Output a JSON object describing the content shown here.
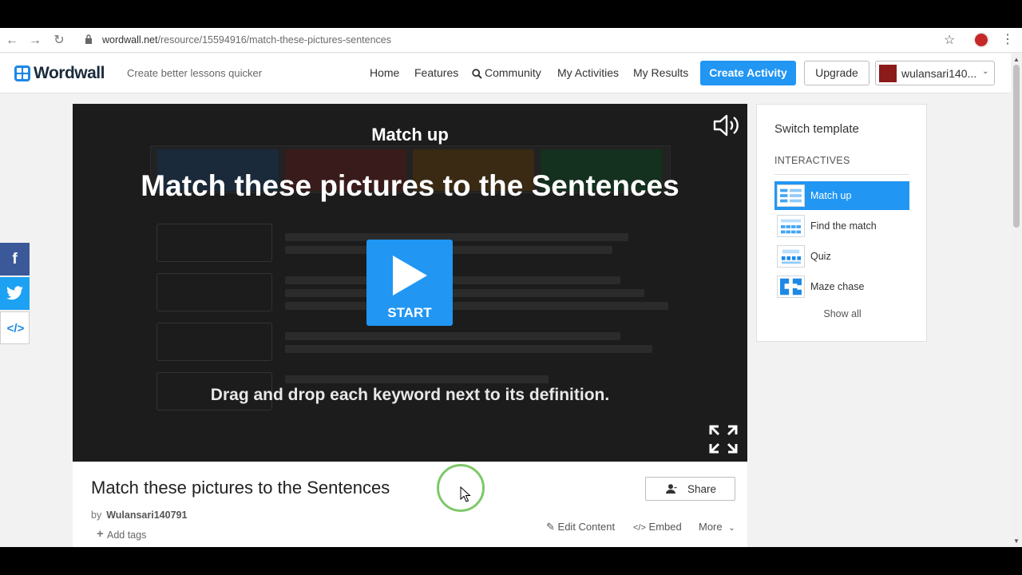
{
  "browser": {
    "url_host": "wordwall.net",
    "url_path": "/resource/15594916/match-these-pictures-sentences"
  },
  "header": {
    "logo": "Wordwall",
    "tagline": "Create better lessons quicker",
    "nav": [
      "Home",
      "Features",
      "Community",
      "My Activities",
      "My Results"
    ],
    "create_button": "Create Activity",
    "upgrade_button": "Upgrade",
    "username": "wulansari140..."
  },
  "player": {
    "template_name": "Match up",
    "heading": "Match these pictures to the Sentences",
    "start_label": "START",
    "instruction": "Drag and drop each keyword next to its definition."
  },
  "info": {
    "title": "Match these pictures to the Sentences",
    "by": "by",
    "author": "Wulansari140791",
    "add_tags": "Add tags",
    "share": "Share",
    "edit_content": "Edit Content",
    "embed": "Embed",
    "more": "More"
  },
  "templates": {
    "title": "Switch template",
    "section": "INTERACTIVES",
    "items": [
      "Match up",
      "Find the match",
      "Quiz",
      "Maze chase"
    ],
    "show_all": "Show all"
  },
  "colors": {
    "accent": "#2196f3",
    "facebook": "#3b5998",
    "twitter": "#1da1f2"
  }
}
